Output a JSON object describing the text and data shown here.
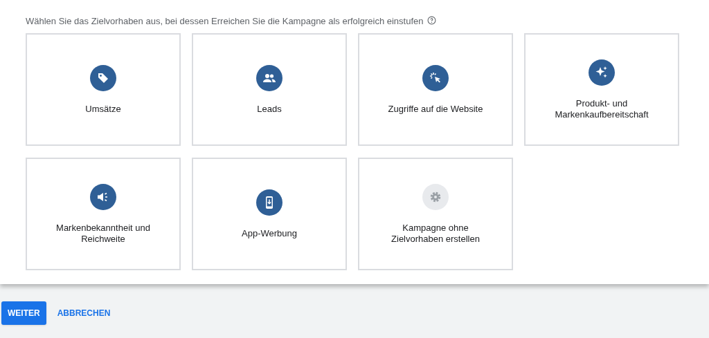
{
  "prompt": "Wählen Sie das Zielvorhaben aus, bei dessen Erreichen Sie die Kampagne als erfolgreich einstufen",
  "goals": [
    {
      "label": "Umsätze",
      "kind": "tag",
      "selected": false
    },
    {
      "label": "Leads",
      "kind": "people",
      "selected": false
    },
    {
      "label": "Zugriffe auf die Website",
      "kind": "click",
      "selected": false
    },
    {
      "label": "Produkt- und Markenkaufbereitschaft",
      "kind": "sparkle",
      "selected": false
    },
    {
      "label": "Markenbekanntheit und Reichweite",
      "kind": "speaker",
      "selected": false
    },
    {
      "label": "App-Werbung",
      "kind": "phone",
      "selected": false
    },
    {
      "label": "Kampagne ohne Zielvorhaben erstellen",
      "kind": "gear",
      "selected": false
    }
  ],
  "buttons": [
    {
      "label": "WEITER",
      "kind": "primary"
    },
    {
      "label": "ABBRECHEN",
      "kind": "text"
    }
  ]
}
